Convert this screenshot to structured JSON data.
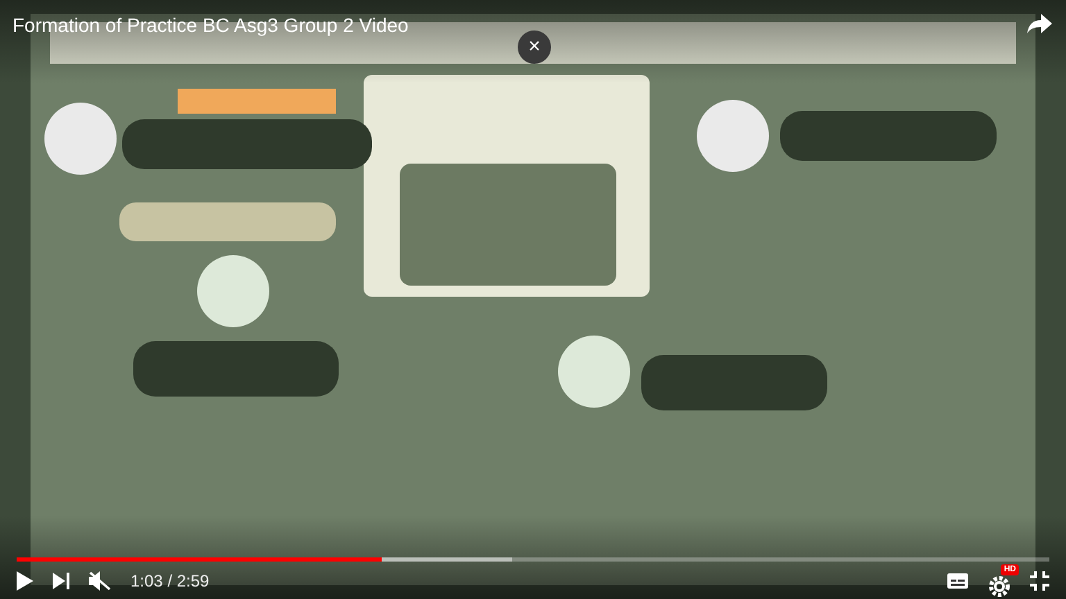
{
  "player": {
    "title": "Formation of Practice BC Asg3 Group 2 Video",
    "close_button": "×",
    "progress": {
      "level": 0.353
    },
    "muted": true,
    "time": "1:03 / 2:59",
    "settings_badge": "HD"
  }
}
